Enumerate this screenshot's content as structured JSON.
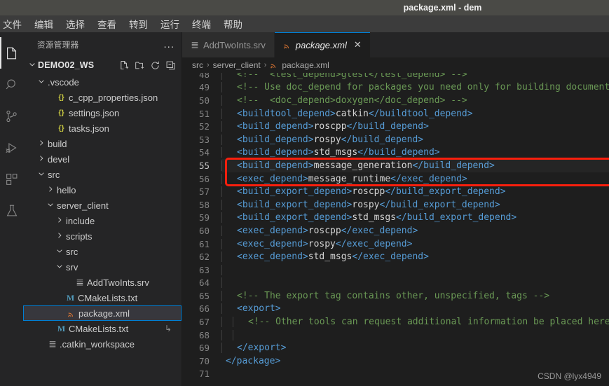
{
  "window": {
    "title": "package.xml - dem"
  },
  "menubar": {
    "items": [
      "文件",
      "编辑",
      "选择",
      "查看",
      "转到",
      "运行",
      "终端",
      "帮助"
    ]
  },
  "activitybar": {
    "items": [
      {
        "name": "explorer-icon",
        "active": true
      },
      {
        "name": "search-icon",
        "active": false
      },
      {
        "name": "source-control-icon",
        "active": false
      },
      {
        "name": "run-debug-icon",
        "active": false
      },
      {
        "name": "extensions-icon",
        "active": false
      },
      {
        "name": "testing-icon",
        "active": false
      }
    ]
  },
  "sidebar": {
    "title": "资源管理器",
    "more_label": "...",
    "root": {
      "label": "DEMO02_WS",
      "expanded": true,
      "actions": [
        "new-file-icon",
        "new-folder-icon",
        "refresh-icon",
        "collapse-all-icon"
      ]
    },
    "tree": [
      {
        "label": ".vscode",
        "indent": 1,
        "twisty": "down",
        "icon": "folder",
        "selected": false
      },
      {
        "label": "c_cpp_properties.json",
        "indent": 2,
        "twisty": "none",
        "icon": "json",
        "selected": false
      },
      {
        "label": "settings.json",
        "indent": 2,
        "twisty": "none",
        "icon": "json",
        "selected": false
      },
      {
        "label": "tasks.json",
        "indent": 2,
        "twisty": "none",
        "icon": "json",
        "selected": false
      },
      {
        "label": "build",
        "indent": 1,
        "twisty": "right",
        "icon": "folder",
        "selected": false
      },
      {
        "label": "devel",
        "indent": 1,
        "twisty": "right",
        "icon": "folder",
        "selected": false
      },
      {
        "label": "src",
        "indent": 1,
        "twisty": "down",
        "icon": "folder",
        "selected": false
      },
      {
        "label": "hello",
        "indent": 2,
        "twisty": "right",
        "icon": "folder",
        "selected": false
      },
      {
        "label": "server_client",
        "indent": 2,
        "twisty": "down",
        "icon": "folder",
        "selected": false
      },
      {
        "label": "include",
        "indent": 3,
        "twisty": "right",
        "icon": "folder",
        "selected": false
      },
      {
        "label": "scripts",
        "indent": 3,
        "twisty": "right",
        "icon": "folder",
        "selected": false
      },
      {
        "label": "src",
        "indent": 3,
        "twisty": "down",
        "icon": "folder",
        "selected": false
      },
      {
        "label": "srv",
        "indent": 3,
        "twisty": "down",
        "icon": "folder",
        "selected": false
      },
      {
        "label": "AddTwoInts.srv",
        "indent": 4,
        "twisty": "none",
        "icon": "txtish",
        "selected": false
      },
      {
        "label": "CMakeLists.txt",
        "indent": 3,
        "twisty": "none",
        "icon": "md",
        "selected": false
      },
      {
        "label": "package.xml",
        "indent": 3,
        "twisty": "none",
        "icon": "xml",
        "selected": true
      },
      {
        "label": "CMakeLists.txt",
        "indent": 2,
        "twisty": "none",
        "icon": "md",
        "selected": false,
        "tail": "↳"
      },
      {
        "label": ".catkin_workspace",
        "indent": 1,
        "twisty": "none",
        "icon": "txtish",
        "selected": false
      }
    ]
  },
  "tabs": [
    {
      "label": "AddTwoInts.srv",
      "icon": "srv-file-icon",
      "active": false,
      "closable": false
    },
    {
      "label": "package.xml",
      "icon": "xml-file-icon",
      "active": true,
      "closable": true,
      "close_label": "✕"
    }
  ],
  "breadcrumb": {
    "parts": [
      "src",
      "server_client",
      "package.xml"
    ],
    "separator": "›"
  },
  "editor": {
    "first_line_number": 48,
    "current_line": 55,
    "lines": [
      {
        "n": 48,
        "indent": 1,
        "tokens": [
          {
            "t": "cmt",
            "s": "<!--  <test_depend>gtest</test_depend> -->"
          }
        ]
      },
      {
        "n": 49,
        "indent": 1,
        "tokens": [
          {
            "t": "cmt",
            "s": "<!-- Use doc_depend for packages you need only for building documentation: -->"
          }
        ]
      },
      {
        "n": 50,
        "indent": 1,
        "tokens": [
          {
            "t": "cmt",
            "s": "<!--  <doc_depend>doxygen</doc_depend> -->"
          }
        ]
      },
      {
        "n": 51,
        "indent": 1,
        "tokens": [
          {
            "t": "tag",
            "s": "<buildtool_depend>"
          },
          {
            "t": "txt",
            "s": "catkin"
          },
          {
            "t": "tag",
            "s": "</buildtool_depend>"
          }
        ]
      },
      {
        "n": 52,
        "indent": 1,
        "tokens": [
          {
            "t": "tag",
            "s": "<build_depend>"
          },
          {
            "t": "txt",
            "s": "roscpp"
          },
          {
            "t": "tag",
            "s": "</build_depend>"
          }
        ]
      },
      {
        "n": 53,
        "indent": 1,
        "tokens": [
          {
            "t": "tag",
            "s": "<build_depend>"
          },
          {
            "t": "txt",
            "s": "rospy"
          },
          {
            "t": "tag",
            "s": "</build_depend>"
          }
        ]
      },
      {
        "n": 54,
        "indent": 1,
        "tokens": [
          {
            "t": "tag",
            "s": "<build_depend>"
          },
          {
            "t": "txt",
            "s": "std_msgs"
          },
          {
            "t": "tag",
            "s": "</build_depend>"
          }
        ]
      },
      {
        "n": 55,
        "indent": 1,
        "tokens": [
          {
            "t": "tag",
            "s": "<build_depend>"
          },
          {
            "t": "txt",
            "s": "message_generation"
          },
          {
            "t": "tag",
            "s": "</build_depend>"
          }
        ]
      },
      {
        "n": 56,
        "indent": 1,
        "tokens": [
          {
            "t": "tag",
            "s": "<exec_depend>"
          },
          {
            "t": "txt",
            "s": "message_runtime"
          },
          {
            "t": "tag",
            "s": "</exec_depend>"
          }
        ]
      },
      {
        "n": 57,
        "indent": 1,
        "tokens": [
          {
            "t": "tag",
            "s": "<build_export_depend>"
          },
          {
            "t": "txt",
            "s": "roscpp"
          },
          {
            "t": "tag",
            "s": "</build_export_depend>"
          }
        ]
      },
      {
        "n": 58,
        "indent": 1,
        "tokens": [
          {
            "t": "tag",
            "s": "<build_export_depend>"
          },
          {
            "t": "txt",
            "s": "rospy"
          },
          {
            "t": "tag",
            "s": "</build_export_depend>"
          }
        ]
      },
      {
        "n": 59,
        "indent": 1,
        "tokens": [
          {
            "t": "tag",
            "s": "<build_export_depend>"
          },
          {
            "t": "txt",
            "s": "std_msgs"
          },
          {
            "t": "tag",
            "s": "</build_export_depend>"
          }
        ]
      },
      {
        "n": 60,
        "indent": 1,
        "tokens": [
          {
            "t": "tag",
            "s": "<exec_depend>"
          },
          {
            "t": "txt",
            "s": "roscpp"
          },
          {
            "t": "tag",
            "s": "</exec_depend>"
          }
        ]
      },
      {
        "n": 61,
        "indent": 1,
        "tokens": [
          {
            "t": "tag",
            "s": "<exec_depend>"
          },
          {
            "t": "txt",
            "s": "rospy"
          },
          {
            "t": "tag",
            "s": "</exec_depend>"
          }
        ]
      },
      {
        "n": 62,
        "indent": 1,
        "tokens": [
          {
            "t": "tag",
            "s": "<exec_depend>"
          },
          {
            "t": "txt",
            "s": "std_msgs"
          },
          {
            "t": "tag",
            "s": "</exec_depend>"
          }
        ]
      },
      {
        "n": 63,
        "indent": 1,
        "tokens": []
      },
      {
        "n": 64,
        "indent": 1,
        "tokens": []
      },
      {
        "n": 65,
        "indent": 1,
        "tokens": [
          {
            "t": "cmt",
            "s": "<!-- The export tag contains other, unspecified, tags -->"
          }
        ]
      },
      {
        "n": 66,
        "indent": 1,
        "tokens": [
          {
            "t": "tag",
            "s": "<export>"
          }
        ]
      },
      {
        "n": 67,
        "indent": 2,
        "tokens": [
          {
            "t": "cmt",
            "s": "<!-- Other tools can request additional information be placed here -->"
          }
        ]
      },
      {
        "n": 68,
        "indent": 2,
        "tokens": []
      },
      {
        "n": 69,
        "indent": 1,
        "tokens": [
          {
            "t": "tag",
            "s": "</export>"
          }
        ]
      },
      {
        "n": 70,
        "indent": 0,
        "tokens": [
          {
            "t": "tag",
            "s": "</package>"
          }
        ]
      },
      {
        "n": 71,
        "indent": 0,
        "tokens": []
      }
    ],
    "annotation": {
      "type": "red-rectangle",
      "color": "#f91f0d",
      "covers_lines": [
        55,
        56
      ]
    }
  },
  "watermark": {
    "text": "CSDN @lyx4949"
  },
  "colors": {
    "accent": "#007fd4",
    "annotation": "#f91f0d",
    "tag": "#569cd6",
    "text": "#d4d4d4",
    "comment": "#6a9955",
    "json_icon": "#cbcb41",
    "xml_icon": "#e37933",
    "md_icon": "#519aba"
  }
}
